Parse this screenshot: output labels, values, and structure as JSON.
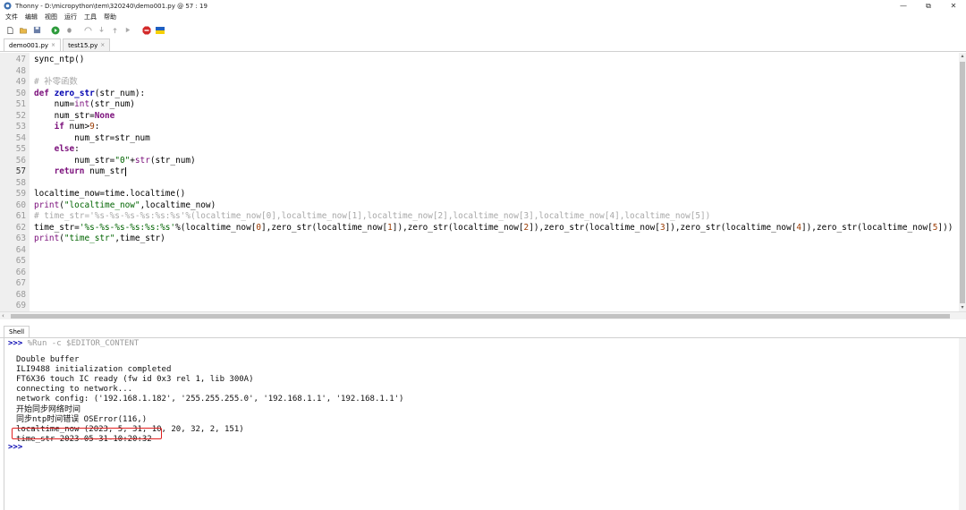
{
  "window": {
    "title": "Thonny  -  D:\\micropython\\tem\\320240\\demo001.py  @  57 : 19",
    "controls": [
      "—",
      "⧉",
      "✕"
    ]
  },
  "menu": [
    "文件",
    "编辑",
    "视图",
    "运行",
    "工具",
    "帮助"
  ],
  "toolbar": {
    "buttons": [
      "new-file-icon",
      "open-file-icon",
      "save-icon",
      "run-icon",
      "debug-icon",
      "step-over-icon",
      "step-into-icon",
      "step-out-icon",
      "resume-icon",
      "stop-icon",
      "ukraine-flag-icon"
    ]
  },
  "tabs": [
    {
      "label": "demo001.py",
      "close": "×",
      "active": true
    },
    {
      "label": "test15.py",
      "close": "×",
      "active": false
    }
  ],
  "editor": {
    "current_line": "57",
    "lines": [
      {
        "n": "47",
        "t": "sync_ntp()"
      },
      {
        "n": "48",
        "t": ""
      },
      {
        "n": "49",
        "t": "# 补零函数"
      },
      {
        "n": "50",
        "t": "def zero_str(str_num):"
      },
      {
        "n": "51",
        "t": "    num=int(str_num)"
      },
      {
        "n": "52",
        "t": "    num_str=None"
      },
      {
        "n": "53",
        "t": "    if num>9:"
      },
      {
        "n": "54",
        "t": "        num_str=str_num"
      },
      {
        "n": "55",
        "t": "    else:"
      },
      {
        "n": "56",
        "t": "        num_str=\"0\"+str(str_num)"
      },
      {
        "n": "57",
        "t": "    return num_str"
      },
      {
        "n": "58",
        "t": ""
      },
      {
        "n": "59",
        "t": "localtime_now=time.localtime()"
      },
      {
        "n": "60",
        "t": "print(\"localtime_now\",localtime_now)"
      },
      {
        "n": "61",
        "t": "# time_str='%s-%s-%s-%s:%s:%s'%(localtime_now[0],localtime_now[1],localtime_now[2],localtime_now[3],localtime_now[4],localtime_now[5])"
      },
      {
        "n": "62",
        "t": "time_str='%s-%s-%s-%s:%s:%s'%(localtime_now[0],zero_str(localtime_now[1]),zero_str(localtime_now[2]),zero_str(localtime_now[3]),zero_str(localtime_now[4]),zero_str(localtime_now[5]))"
      },
      {
        "n": "63",
        "t": "print(\"time_str\",time_str)"
      },
      {
        "n": "64",
        "t": ""
      },
      {
        "n": "65",
        "t": ""
      },
      {
        "n": "66",
        "t": ""
      },
      {
        "n": "67",
        "t": ""
      },
      {
        "n": "68",
        "t": ""
      },
      {
        "n": "69",
        "t": ""
      }
    ]
  },
  "scroll": {
    "up": "▴",
    "down": "▾",
    "left": "‹"
  },
  "shell": {
    "tab_label": "Shell",
    "prompt": ">>>",
    "command": " %Run -c $EDITOR_CONTENT",
    "output": [
      "Double buffer",
      "ILI9488 initialization completed",
      "FT6X36 touch IC ready (fw id 0x3 rel 1, lib 300A)",
      "connecting to network...",
      "network config: ('192.168.1.182', '255.255.255.0', '192.168.1.1', '192.168.1.1')",
      "开始同步网络时间",
      "同步ntp时间错误 OSError(116,)",
      "localtime_now (2023, 5, 31, 10, 20, 32, 2, 151)",
      "time_str 2023-05-31-10:20:32"
    ],
    "final_prompt": ">>>"
  }
}
